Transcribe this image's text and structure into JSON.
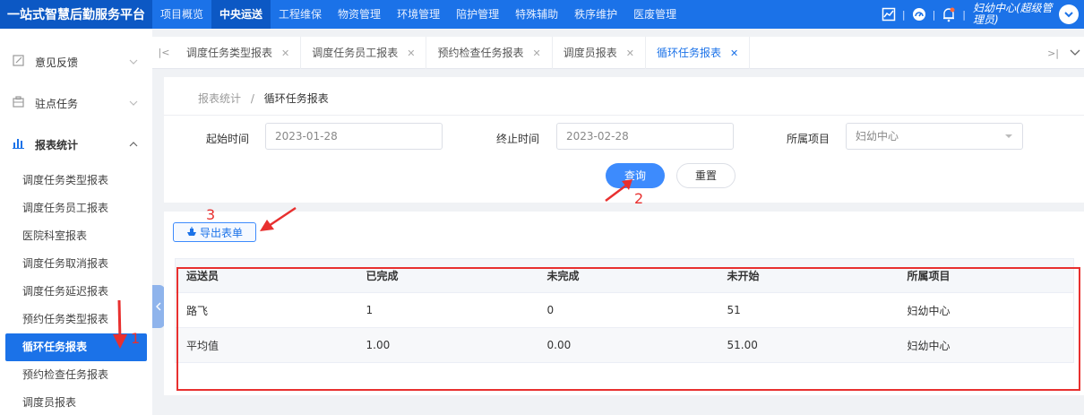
{
  "app": {
    "title": "一站式智慧后勤服务平台"
  },
  "top_nav": [
    {
      "label": "项目概览",
      "active": false
    },
    {
      "label": "中央运送",
      "active": true
    },
    {
      "label": "工程维保",
      "active": false
    },
    {
      "label": "物资管理",
      "active": false
    },
    {
      "label": "环境管理",
      "active": false
    },
    {
      "label": "陪护管理",
      "active": false
    },
    {
      "label": "特殊辅助",
      "active": false
    },
    {
      "label": "秩序维护",
      "active": false
    },
    {
      "label": "医废管理",
      "active": false
    }
  ],
  "user": {
    "name": "妇幼中心(超级管理员)"
  },
  "sidebar": {
    "groups": [
      {
        "label": "意见反馈",
        "icon": "edit-icon"
      },
      {
        "label": "驻点任务",
        "icon": "briefcase-icon"
      },
      {
        "label": "报表统计",
        "icon": "bar-chart-icon"
      }
    ],
    "items": [
      {
        "label": "调度任务类型报表"
      },
      {
        "label": "调度任务员工报表"
      },
      {
        "label": "医院科室报表"
      },
      {
        "label": "调度任务取消报表"
      },
      {
        "label": "调度任务延迟报表"
      },
      {
        "label": "预约任务类型报表"
      },
      {
        "label": "循环任务报表",
        "active": true
      },
      {
        "label": "预约检查任务报表"
      },
      {
        "label": "调度员报表"
      }
    ]
  },
  "tabs": [
    {
      "label": "调度任务类型报表"
    },
    {
      "label": "调度任务员工报表"
    },
    {
      "label": "预约检查任务报表"
    },
    {
      "label": "调度员报表"
    },
    {
      "label": "循环任务报表",
      "active": true
    }
  ],
  "breadcrumb": {
    "parent": "报表统计",
    "separator": "/",
    "current": "循环任务报表"
  },
  "search": {
    "start_label": "起始时间",
    "start_value": "2023-01-28",
    "end_label": "终止时间",
    "end_value": "2023-02-28",
    "project_label": "所属项目",
    "project_value": "妇幼中心",
    "query_button": "查询",
    "reset_button": "重置"
  },
  "export_button": "导出表单",
  "table": {
    "columns": [
      "运送员",
      "已完成",
      "未完成",
      "未开始",
      "所属项目"
    ],
    "rows": [
      [
        "路飞",
        "1",
        "0",
        "51",
        "妇幼中心"
      ],
      [
        "平均值",
        "1.00",
        "0.00",
        "51.00",
        "妇幼中心"
      ]
    ]
  },
  "annotations": [
    "1",
    "2",
    "3"
  ],
  "colors": {
    "primary": "#1b72e8",
    "annotation": "#e8302f"
  }
}
